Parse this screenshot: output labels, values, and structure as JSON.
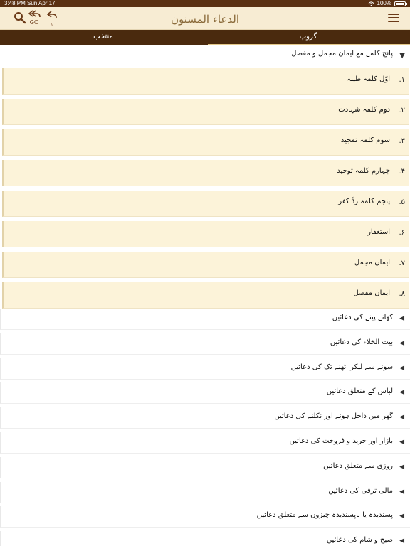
{
  "status_bar": {
    "time": "3:48 PM",
    "date": "Sun Apr 17",
    "battery": "100%"
  },
  "navbar": {
    "title": "الدعاء المسنون",
    "go_label": "GO",
    "back_label": "۱"
  },
  "tabs": {
    "right": "گروپ",
    "left": "منتخب",
    "active": "right"
  },
  "group": {
    "label": "پانچ کلمے مع ایمان مجمل و مفصل"
  },
  "sub_items": [
    {
      "num": "۱.",
      "label": "اوّل کلمہ طیبہ"
    },
    {
      "num": "۲.",
      "label": "دوم کلمہ شہادت"
    },
    {
      "num": "۳.",
      "label": "سوم کلمہ تمجید"
    },
    {
      "num": "۴.",
      "label": "چہارم کلمہ توحید"
    },
    {
      "num": "۵.",
      "label": "پنجم کلمہ ردِّ کفر"
    },
    {
      "num": "۶.",
      "label": "استغفار"
    },
    {
      "num": "۷.",
      "label": "ایمان مجمل"
    },
    {
      "num": "۸.",
      "label": "ایمان مفصل"
    }
  ],
  "categories": [
    "کھانے پینے کی دعائیں",
    "بیت الخلاء کی دعائیں",
    "سونے سے لیکر اٹھنے تک کی دعائیں",
    "لباس کے متعلق دعائیں",
    "گھر میں داخل ہونے اور نکلنے کی دعائیں",
    "بازار اور خرید و فروخت کی دعائیں",
    "روزی سے متعلق دعائیں",
    "مالی ترقی کی دعائیں",
    "پسندیدہ یا ناپسندیدہ چیزوں سے متعلق دعائیں",
    "صبح و شام کی دعائیں"
  ],
  "colors": {
    "status_bar": "#5a3012",
    "navbar": "#f7ecd3",
    "tabbar": "#4a2a0e",
    "sub_item_bg": "#fcf3d9",
    "accent_text": "#6b3a18"
  },
  "icons": {
    "search": "search-icon",
    "go": "reply-all-icon",
    "back": "reply-icon",
    "menu": "hamburger-menu-icon"
  }
}
